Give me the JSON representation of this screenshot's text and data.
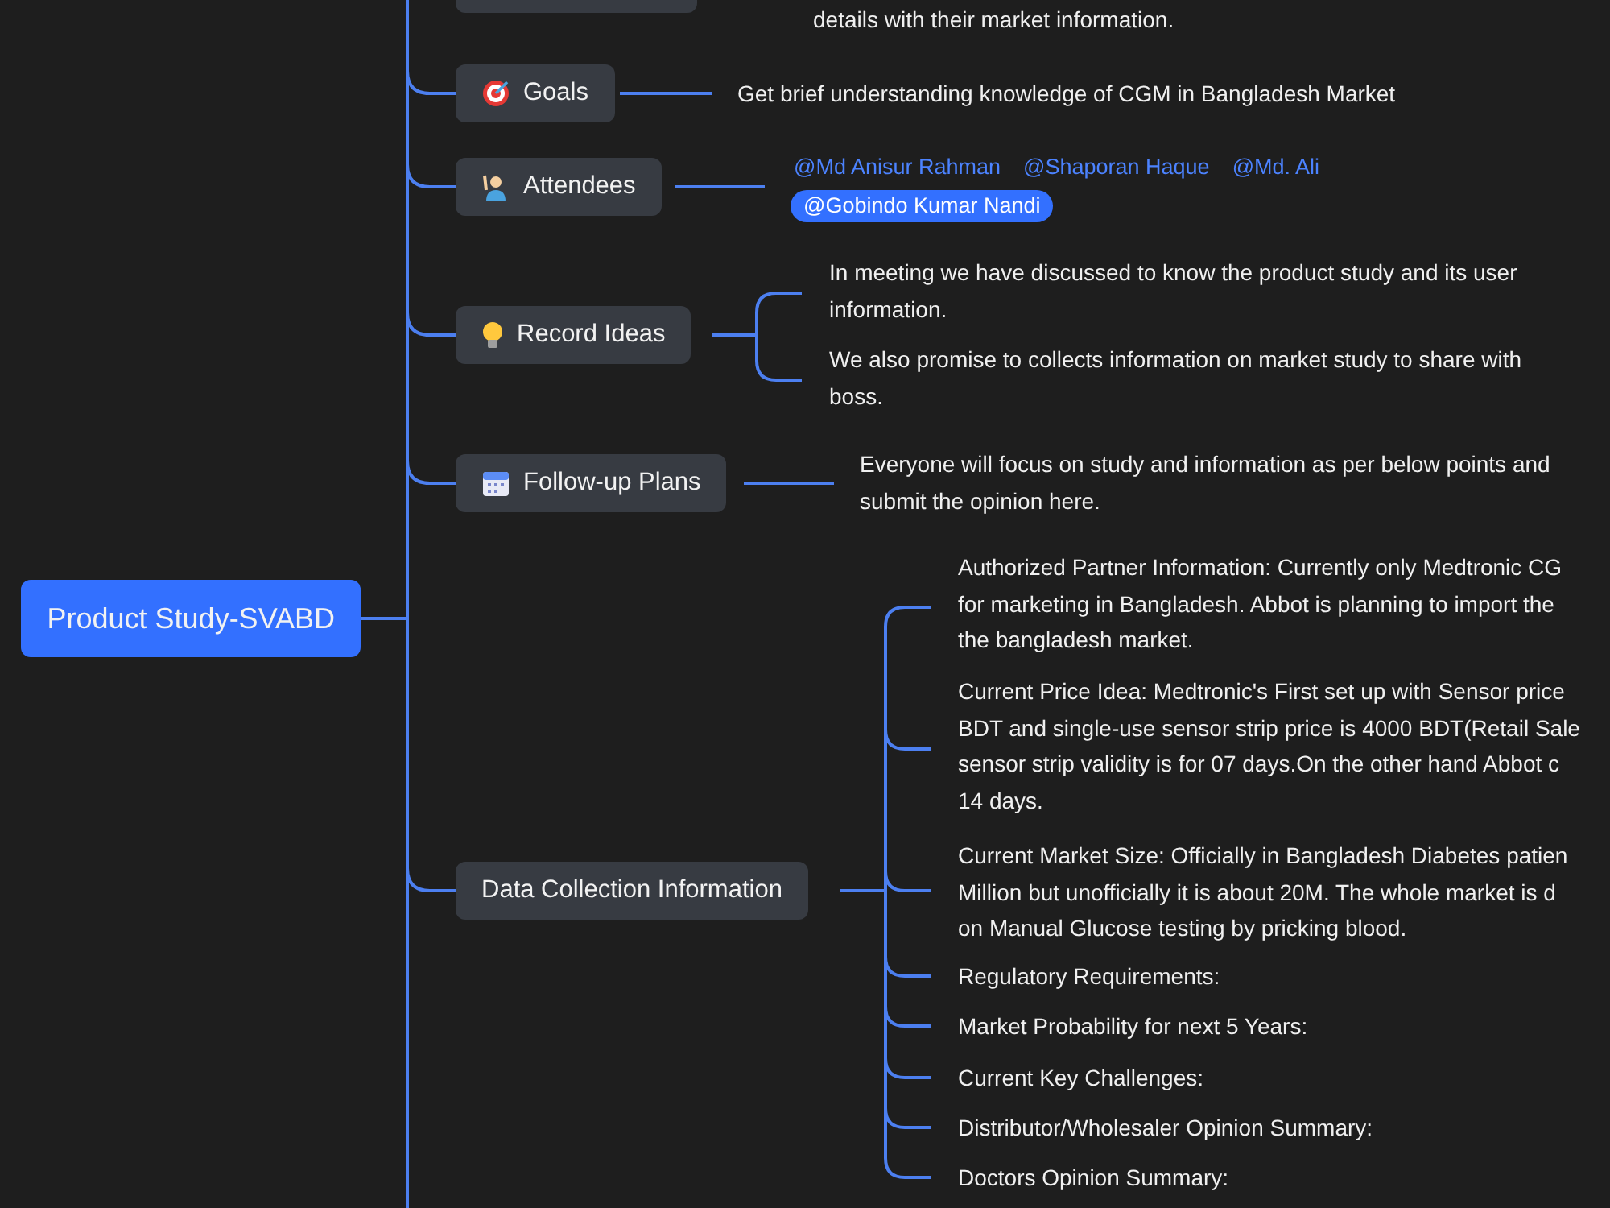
{
  "root": {
    "label": "Product Study-SVABD"
  },
  "top_branch": {
    "details": [
      "details with their market information."
    ]
  },
  "branches": [
    {
      "kind": "text",
      "label": "Goals",
      "items": [
        {
          "lines": [
            "Get brief understanding knowledge of CGM in Bangladesh Market"
          ]
        }
      ]
    },
    {
      "kind": "tags",
      "label": "Attendees",
      "tags": [
        {
          "text": "@Md Anisur Rahman",
          "highlighted": false
        },
        {
          "text": "@Shaporan Haque",
          "highlighted": false
        },
        {
          "text": "@Md. Ali",
          "highlighted": false
        },
        {
          "text": "@Gobindo Kumar Nandi",
          "highlighted": true
        }
      ]
    },
    {
      "kind": "list",
      "label": "Record Ideas",
      "items": [
        {
          "lines": [
            "In meeting we have discussed to know the product study and its user",
            "information."
          ]
        },
        {
          "lines": [
            "We also promise to collects information on market study to share with",
            "boss."
          ]
        }
      ]
    },
    {
      "kind": "text",
      "label": "Follow-up Plans",
      "items": [
        {
          "lines": [
            "Everyone will focus on study and information as per below points and",
            "submit the opinion here."
          ]
        }
      ]
    },
    {
      "kind": "list",
      "label": "Data Collection Information",
      "items": [
        {
          "lines": [
            "Authorized Partner Information: Currently only Medtronic CG",
            "for marketing in Bangladesh. Abbot is planning to import the",
            "the bangladesh market."
          ]
        },
        {
          "lines": [
            "Current Price Idea: Medtronic's First set up with Sensor price",
            "BDT and single-use sensor strip price is 4000 BDT(Retail Sale",
            "sensor strip validity is for 07 days.On the other hand Abbot c",
            "14 days."
          ]
        },
        {
          "lines": [
            "Current Market Size: Officially in Bangladesh Diabetes patien",
            "Million but unofficially it is about 20M. The whole market is d",
            "on Manual Glucose testing by pricking blood."
          ]
        },
        {
          "lines": [
            "Regulatory Requirements:"
          ]
        },
        {
          "lines": [
            "Market Probability for next 5 Years:"
          ]
        },
        {
          "lines": [
            "Current Key Challenges:"
          ]
        },
        {
          "lines": [
            "Distributor/Wholesaler Opinion Summary:"
          ]
        },
        {
          "lines": [
            "Doctors Opinion Summary:"
          ]
        }
      ]
    }
  ]
}
